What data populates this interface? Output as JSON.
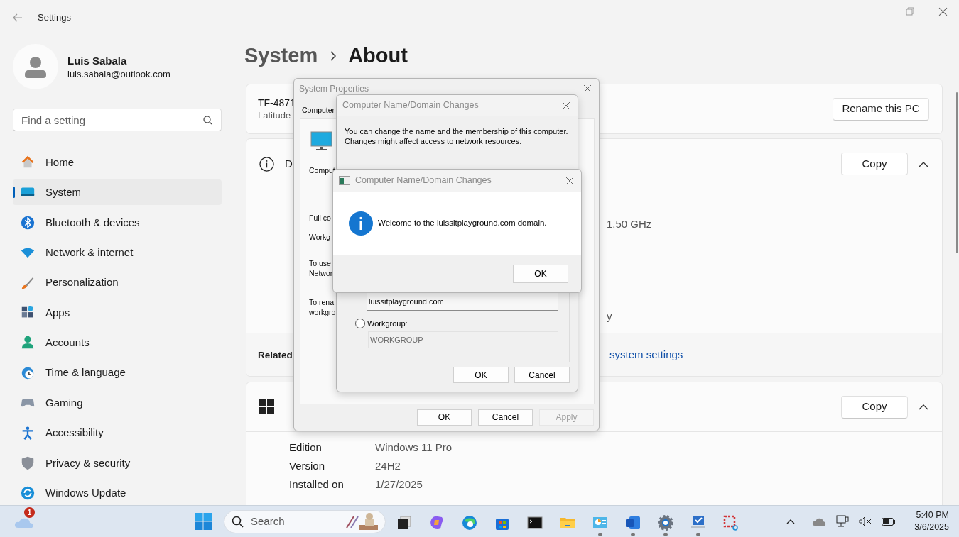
{
  "window": {
    "title": "Settings"
  },
  "account": {
    "name": "Luis Sabala",
    "email": "luis.sabala@outlook.com"
  },
  "search": {
    "placeholder": "Find a setting"
  },
  "nav": [
    {
      "label": "Home",
      "selected": false
    },
    {
      "label": "System",
      "selected": true
    },
    {
      "label": "Bluetooth & devices",
      "selected": false
    },
    {
      "label": "Network & internet",
      "selected": false
    },
    {
      "label": "Personalization",
      "selected": false
    },
    {
      "label": "Apps",
      "selected": false
    },
    {
      "label": "Accounts",
      "selected": false
    },
    {
      "label": "Time & language",
      "selected": false
    },
    {
      "label": "Gaming",
      "selected": false
    },
    {
      "label": "Accessibility",
      "selected": false
    },
    {
      "label": "Privacy & security",
      "selected": false
    },
    {
      "label": "Windows Update",
      "selected": false
    }
  ],
  "breadcrumb": [
    "System",
    "About"
  ],
  "device_card": {
    "name": "TF-4871",
    "model": "Latitude",
    "button": "Rename this PC"
  },
  "device_specs": {
    "heading": "D",
    "button": "Copy",
    "expanded": true,
    "values": [
      "1.50 GHz",
      "y"
    ]
  },
  "related": {
    "label": "Related",
    "link": "system settings"
  },
  "windows_specs": {
    "button": "Copy",
    "expanded": true,
    "rows": [
      {
        "label": "Edition",
        "value": "Windows 11 Pro"
      },
      {
        "label": "Version",
        "value": "24H2"
      },
      {
        "label": "Installed on",
        "value": "1/27/2025"
      }
    ]
  },
  "system_properties": {
    "title": "System Properties",
    "tab": "Computer",
    "texts": [
      [
        "Comput"
      ],
      [
        "Full co"
      ],
      [
        "Workg"
      ],
      [
        "To use",
        "Networ"
      ],
      [
        "To rena",
        "workgro"
      ]
    ],
    "buttons": [
      {
        "label": "OK",
        "disabled": false
      },
      {
        "label": "Cancel",
        "disabled": false
      },
      {
        "label": "Apply",
        "disabled": true
      }
    ]
  },
  "domain_dialog": {
    "title": "Computer Name/Domain Changes",
    "description": "You can change the name and the membership of this computer. Changes might affect access to network resources.",
    "domain_value": "luissitplayground.com",
    "workgroup": {
      "label": "Workgroup:",
      "selected": false,
      "value": "WORKGROUP"
    },
    "buttons": [
      "OK",
      "Cancel"
    ]
  },
  "message_box": {
    "title": "Computer Name/Domain Changes",
    "text": "Welcome to the luissitplayground.com domain.",
    "button": "OK"
  },
  "taskbar": {
    "weather_badge": "1",
    "search_placeholder": "Search",
    "apps": [
      {
        "running": false
      },
      {
        "running": false
      },
      {
        "running": false
      },
      {
        "running": false
      },
      {
        "running": false
      },
      {
        "running": false
      },
      {
        "running": true
      },
      {
        "running": true
      },
      {
        "running": true
      },
      {
        "running": true
      },
      {
        "running": false
      }
    ],
    "time": "5:40 PM",
    "date": "3/6/2025"
  }
}
